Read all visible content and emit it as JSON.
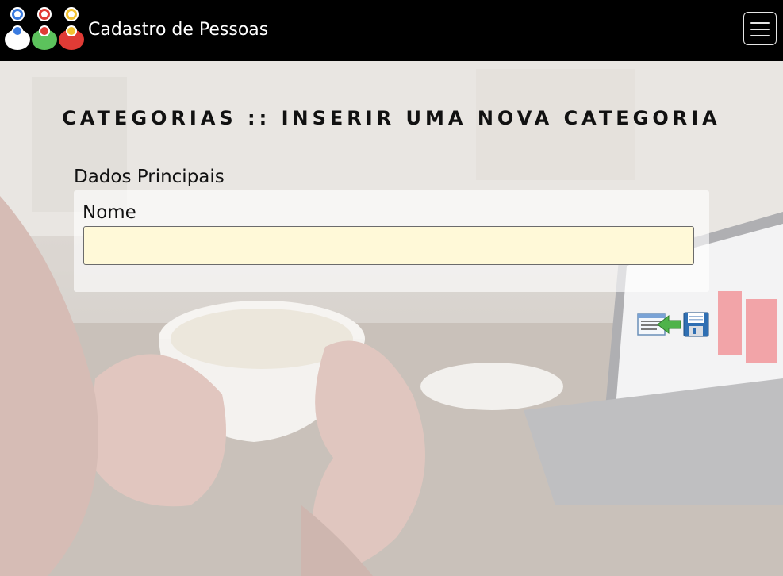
{
  "navbar": {
    "brand": "Cadastro de Pessoas",
    "logo_icon": "people-group-icon",
    "menu_icon": "hamburger-menu-icon"
  },
  "page": {
    "title": "CATEGORIAS :: INSERIR UMA NOVA CATEGORIA"
  },
  "form": {
    "section_title": "Dados Principais",
    "nome": {
      "label": "Nome",
      "value": "",
      "placeholder": ""
    }
  },
  "actions": {
    "list_icon": "back-to-list-icon",
    "save_icon": "floppy-disk-save-icon"
  },
  "colors": {
    "navbar_bg": "#000000",
    "input_bg": "#fff9d8",
    "logo_blue": "#3a7be0",
    "logo_green": "#5cc25c",
    "logo_red": "#e03b35",
    "logo_yellow": "#f2c230"
  }
}
